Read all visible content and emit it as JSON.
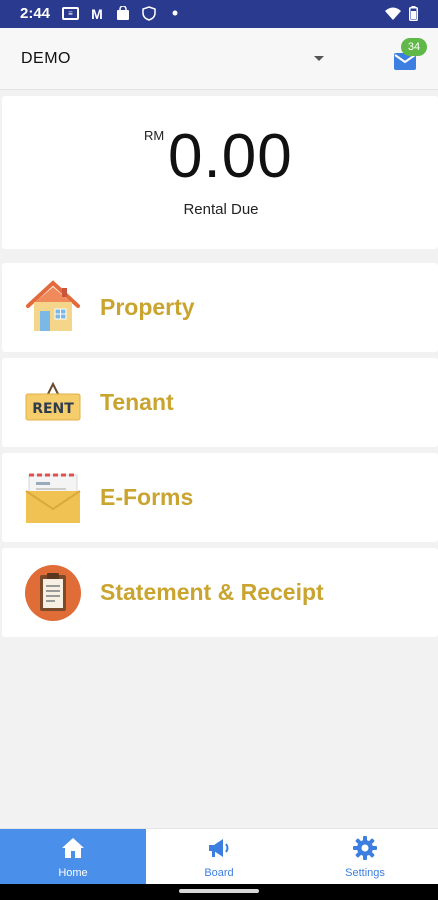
{
  "status_bar": {
    "time": "2:44",
    "icons": [
      "news-icon",
      "gmail-icon",
      "shopping-bag-icon",
      "shield-icon",
      "dot-icon"
    ],
    "right_icons": [
      "wifi-icon",
      "battery-icon"
    ]
  },
  "header": {
    "account": "DEMO",
    "mail_badge": "34"
  },
  "balance": {
    "currency": "RM",
    "amount": "0.00",
    "label": "Rental Due"
  },
  "menu": {
    "items": [
      {
        "label": "Property",
        "icon": "house-icon"
      },
      {
        "label": "Tenant",
        "icon": "rent-sign-icon"
      },
      {
        "label": "E-Forms",
        "icon": "envelope-icon"
      },
      {
        "label": "Statement & Receipt",
        "icon": "clipboard-icon"
      }
    ]
  },
  "rent_sign_text": "RENT",
  "bottom_nav": {
    "tabs": [
      {
        "label": "Home",
        "icon": "home-icon",
        "active": true
      },
      {
        "label": "Board",
        "icon": "megaphone-icon",
        "active": false
      },
      {
        "label": "Settings",
        "icon": "gear-icon",
        "active": false
      }
    ]
  },
  "colors": {
    "status_bar": "#2a3b8f",
    "menu_label": "#c9a42f",
    "nav_active": "#4a8fea",
    "badge": "#5fb848"
  }
}
